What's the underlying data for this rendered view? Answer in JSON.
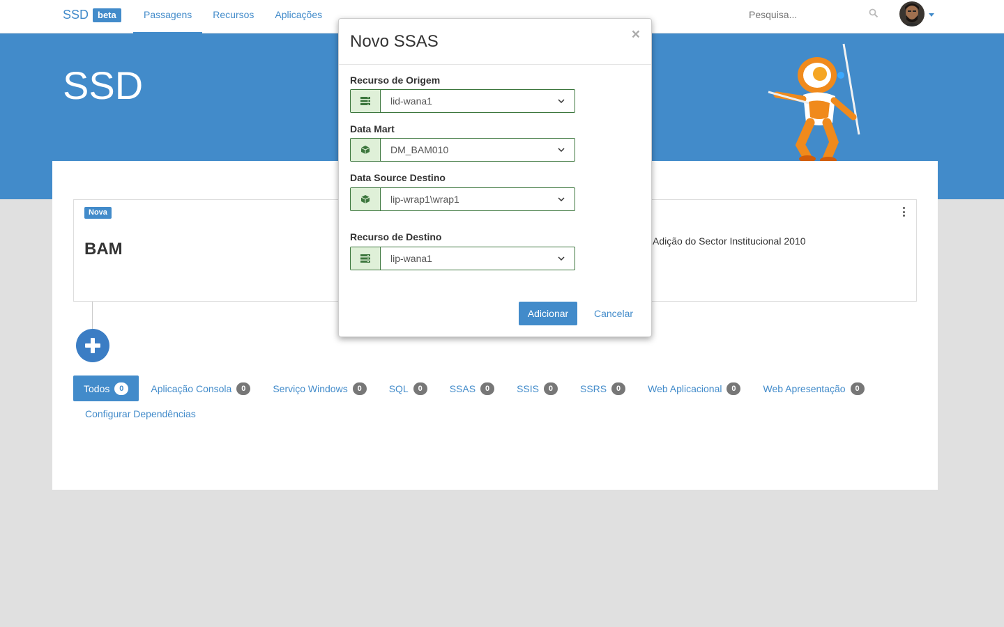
{
  "navbar": {
    "brand": "SSD",
    "brand_badge": "beta",
    "links": [
      {
        "label": "Passagens",
        "active": true
      },
      {
        "label": "Recursos",
        "active": false
      },
      {
        "label": "Aplicações",
        "active": false
      }
    ],
    "search": {
      "placeholder": "Pesquisa..."
    },
    "icons": [
      "search-icon",
      "avatar",
      "caret-down-icon"
    ]
  },
  "hero": {
    "title": "SSD"
  },
  "card": {
    "badge": "Nova",
    "title": "BAM",
    "description": "Adição do Sector Institucional 2010"
  },
  "tabs": [
    {
      "label": "Todos",
      "count": "0",
      "active": true
    },
    {
      "label": "Aplicação Consola",
      "count": "0"
    },
    {
      "label": "Serviço Windows",
      "count": "0"
    },
    {
      "label": "SQL",
      "count": "0"
    },
    {
      "label": "SSAS",
      "count": "0"
    },
    {
      "label": "SSIS",
      "count": "0"
    },
    {
      "label": "SSRS",
      "count": "0"
    },
    {
      "label": "Web Aplicacional",
      "count": "0"
    },
    {
      "label": "Web Apresentação",
      "count": "0"
    }
  ],
  "config_link": "Configurar Dependências",
  "modal": {
    "title": "Novo SSAS",
    "close": "×",
    "fields": [
      {
        "label": "Recurso de Origem",
        "value": "lid-wana1",
        "icon": "server-icon"
      },
      {
        "label": "Data Mart",
        "value": "DM_BAM010",
        "icon": "cube-icon"
      },
      {
        "label": "Data Source Destino",
        "value": "lip-wrap1\\wrap1",
        "icon": "cube-icon"
      },
      {
        "label": "Recurso de Destino",
        "value": "lip-wana1",
        "icon": "server-icon"
      }
    ],
    "submit": "Adicionar",
    "cancel": "Cancelar"
  },
  "colors": {
    "primary": "#428bca",
    "success_border": "#3c763d",
    "success_bg": "#dff0d8",
    "background": "#e0e0e0"
  }
}
